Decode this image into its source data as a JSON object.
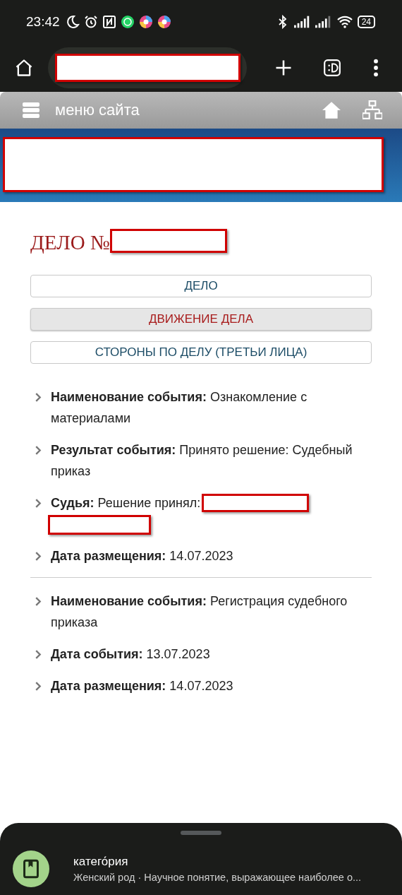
{
  "status_bar": {
    "time": "23:42",
    "battery": "24"
  },
  "site_menu": {
    "label": "меню сайта"
  },
  "case": {
    "title": "ДЕЛО №"
  },
  "tabs": [
    {
      "label": "ДЕЛО",
      "selected": false
    },
    {
      "label": "ДВИЖЕНИЕ ДЕЛА",
      "selected": true
    },
    {
      "label": "СТОРОНЫ ПО ДЕЛУ (ТРЕТЬИ ЛИЦА)",
      "selected": false
    }
  ],
  "events": [
    {
      "fields": [
        {
          "label": "Наименование события:",
          "value": "Ознакомление с материалами"
        },
        {
          "label": "Результат события:",
          "value": "Принято решение: Судебный приказ"
        },
        {
          "label": "Судья:",
          "value": "Решение принял:",
          "redacted": true
        },
        {
          "label": "Дата размещения:",
          "value": "14.07.2023"
        }
      ]
    },
    {
      "fields": [
        {
          "label": "Наименование события:",
          "value": "Регистрация судебного приказа"
        },
        {
          "label": "Дата события:",
          "value": "13.07.2023"
        },
        {
          "label": "Дата размещения:",
          "value": "14.07.2023"
        }
      ]
    }
  ],
  "bottom_sheet": {
    "title": "катего́рия",
    "subtitle": "Женский род · Научное понятие, выражающее наиболее о..."
  }
}
